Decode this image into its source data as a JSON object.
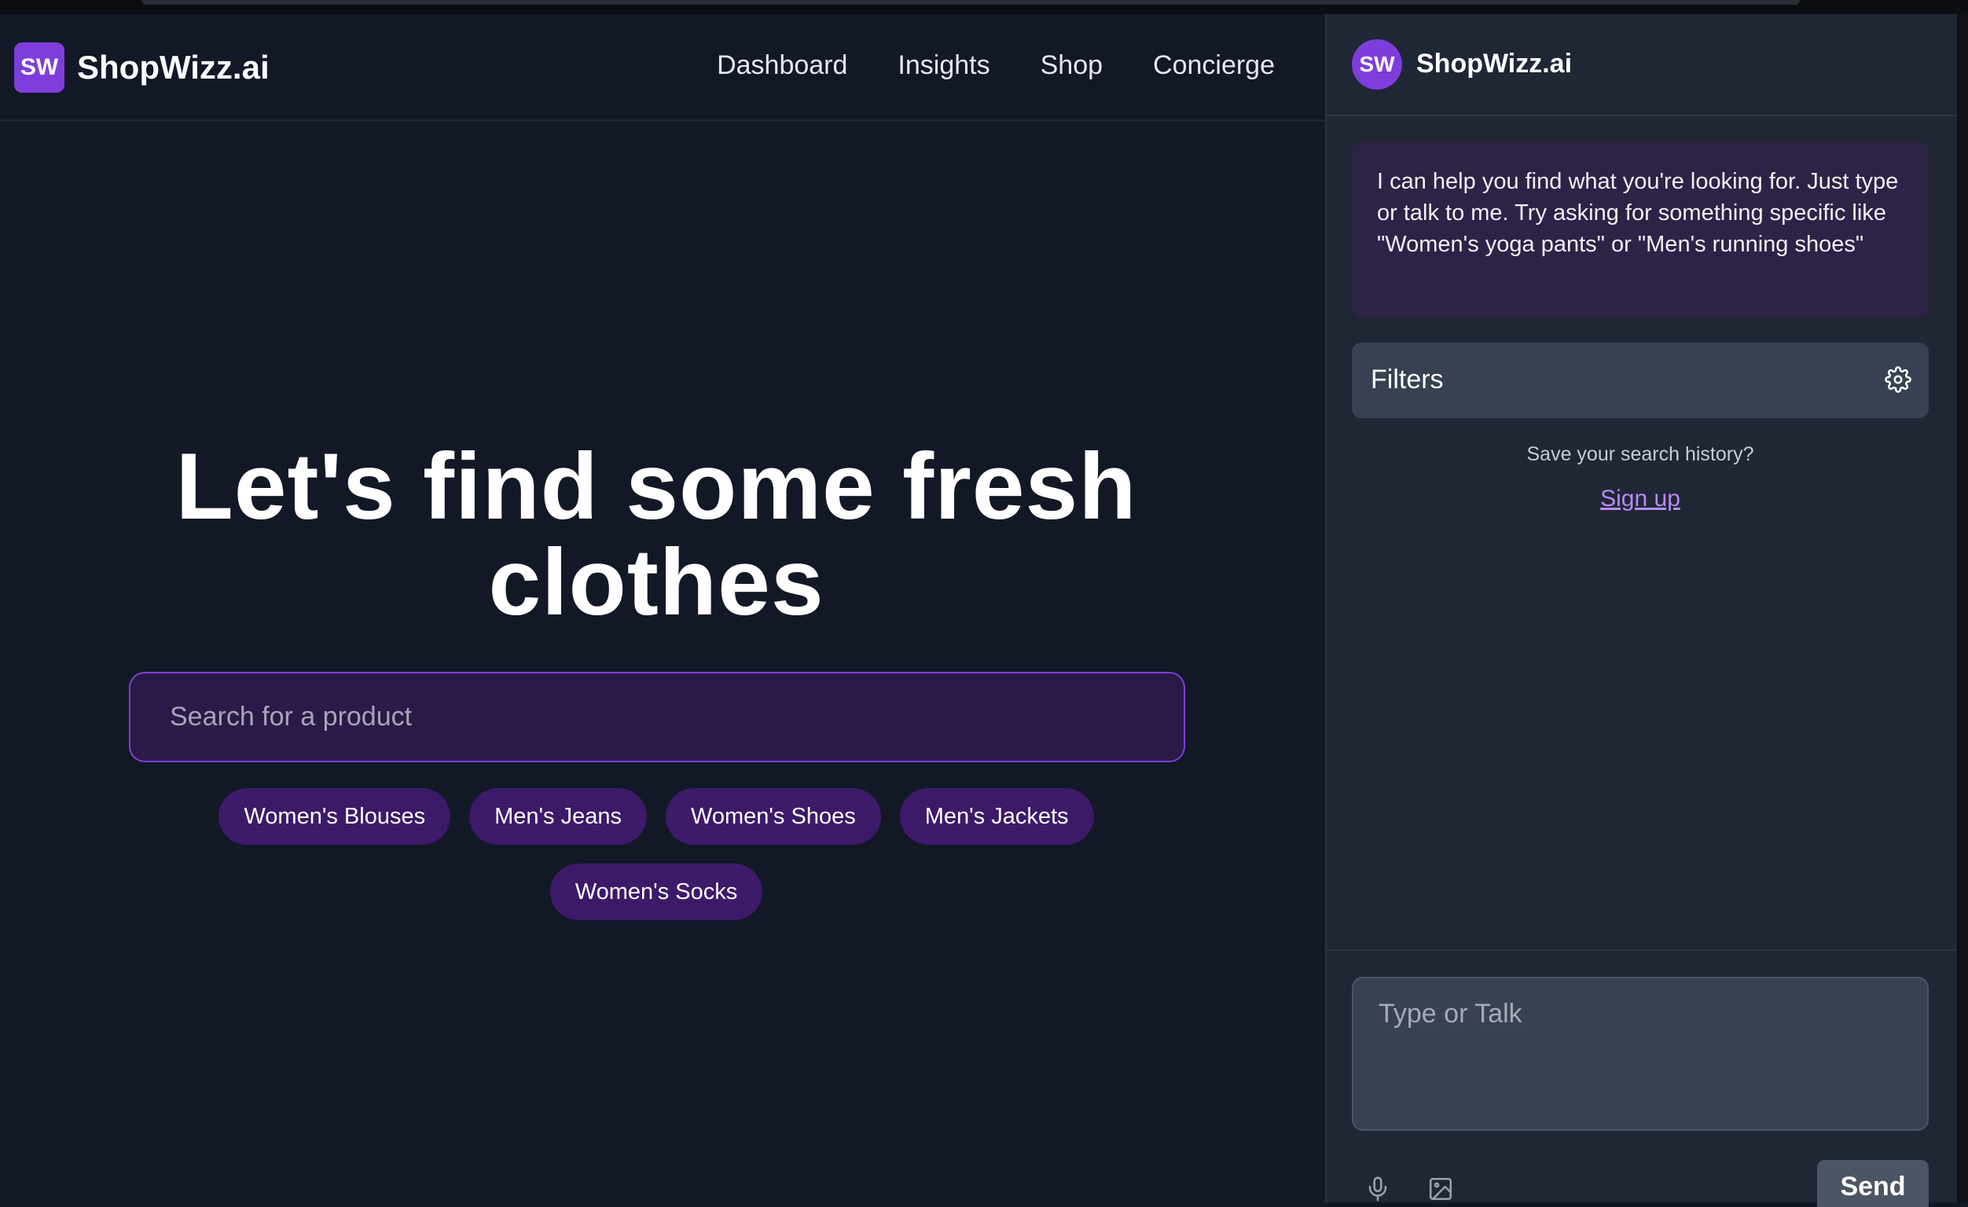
{
  "header": {
    "logo_initials": "SW",
    "brand": "ShopWizz.ai",
    "nav": [
      "Dashboard",
      "Insights",
      "Shop",
      "Concierge"
    ]
  },
  "hero": {
    "title": "Let's find some fresh clothes",
    "search_placeholder": "Search for a product",
    "chips_row1": [
      "Women's Blouses",
      "Men's Jeans",
      "Women's Shoes",
      "Men's Jackets"
    ],
    "chips_row2": [
      "Women's Socks"
    ]
  },
  "panel": {
    "avatar_initials": "SW",
    "brand": "ShopWizz.ai",
    "message": "I can help you find what you're looking for. Just type or talk to me. Try asking for something specific like \"Women's yoga pants\" or \"Men's running shoes\"",
    "filters_label": "Filters",
    "save_prompt": "Save your search history?",
    "signup_label": "Sign up",
    "input_placeholder": "Type or Talk",
    "send_label": "Send",
    "icons": [
      "gear-icon",
      "microphone-icon",
      "image-icon"
    ]
  },
  "colors": {
    "background": "#121826",
    "panel": "#1f2634",
    "accent": "#7e3ddb",
    "chip": "#3c1a69",
    "search_bg": "#2a1a47"
  }
}
